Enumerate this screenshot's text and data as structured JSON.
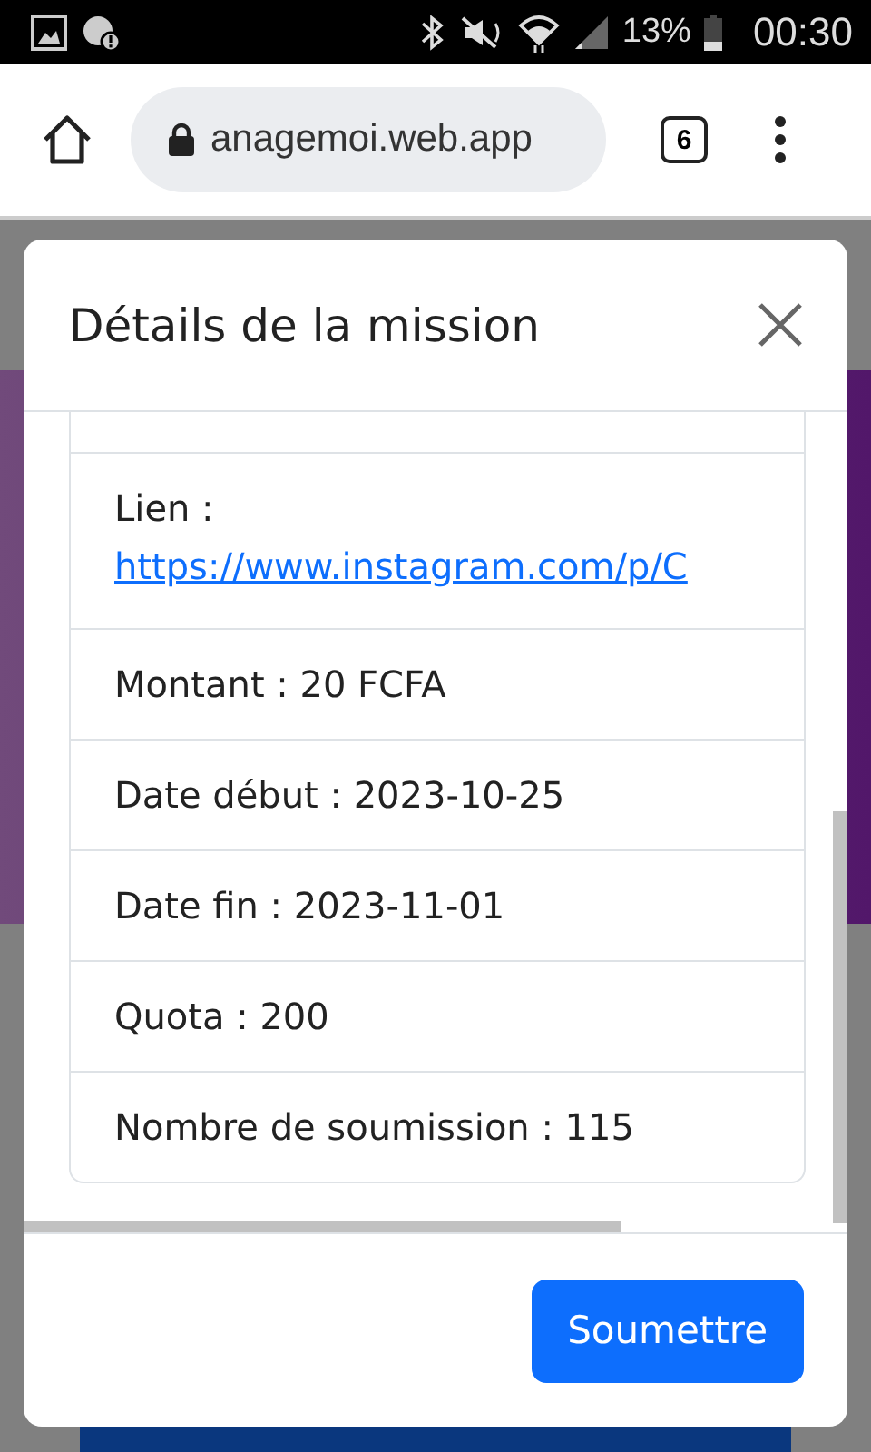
{
  "status_bar": {
    "battery": "13%",
    "time": "00:30"
  },
  "browser": {
    "url": "anagemoi.web.app",
    "tab_count": "6"
  },
  "modal": {
    "title": "Détails de la mission",
    "items": [
      {
        "kind": "blank"
      },
      {
        "kind": "link",
        "label": "Lien :",
        "link": "https://www.instagram.com/p/C"
      },
      {
        "kind": "text",
        "text": "Montant : 20 FCFA"
      },
      {
        "kind": "text",
        "text": "Date début : 2023-10-25"
      },
      {
        "kind": "text",
        "text": "Date fin : 2023-11-01"
      },
      {
        "kind": "text",
        "text": "Quota : 200"
      },
      {
        "kind": "text",
        "text": "Nombre de soumission : 115"
      }
    ],
    "submit_button": "Soumettre"
  }
}
